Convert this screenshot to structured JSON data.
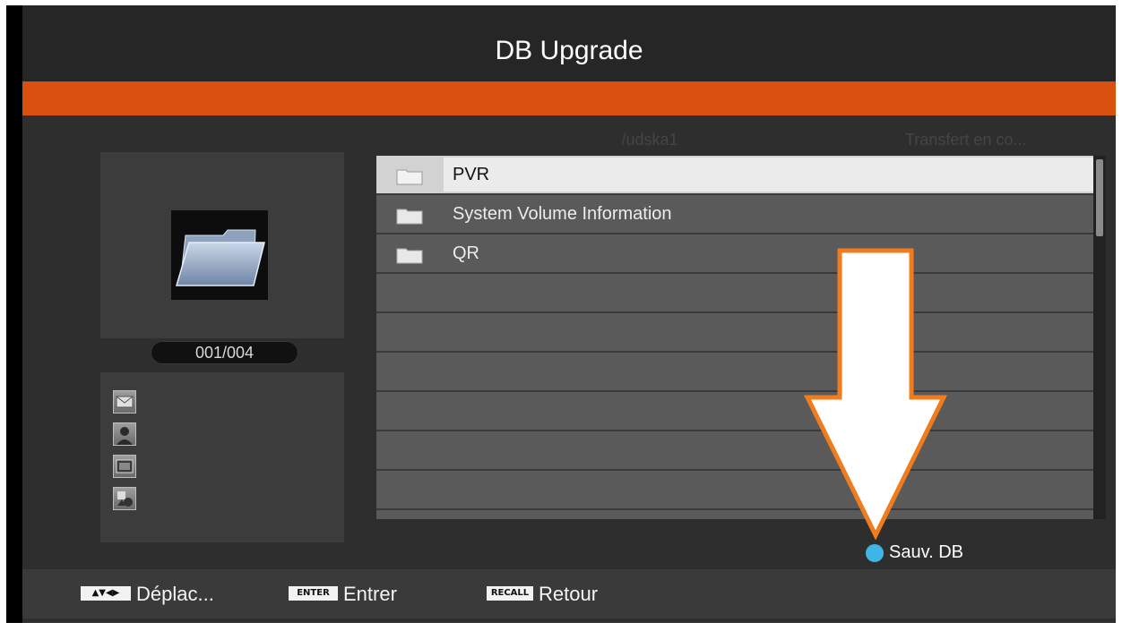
{
  "header": {
    "title": "DB Upgrade"
  },
  "browser": {
    "path": "/udska1",
    "status": "Transfert en co...",
    "counter": "001/004",
    "items": [
      {
        "label": "PVR",
        "selected": true
      },
      {
        "label": "System Volume Information",
        "selected": false
      },
      {
        "label": "QR",
        "selected": false
      }
    ]
  },
  "media_icons": [
    "mail-icon",
    "person-icon",
    "film-icon",
    "shapes-icon"
  ],
  "color_action": {
    "color": "#3fb6e6",
    "label": "Sauv. DB"
  },
  "colors": {
    "accent": "#d9500f",
    "arrow_outline": "#f07c1e"
  },
  "footer": {
    "move_key": "▲▼◀▶",
    "move_label": "Déplac...",
    "enter_key": "ENTER",
    "enter_label": "Entrer",
    "recall_key": "RECALL",
    "recall_label": "Retour"
  }
}
